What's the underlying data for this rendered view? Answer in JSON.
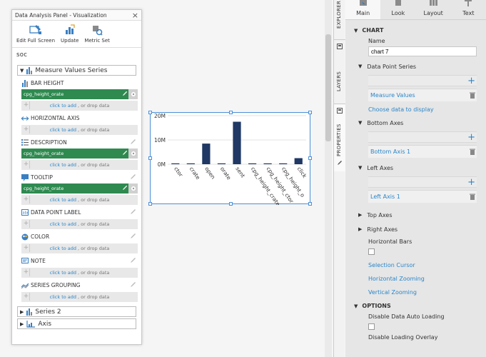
{
  "panel": {
    "title": "Data Analysis Panel - Visualization",
    "close_symbol": "×",
    "toolbar": [
      {
        "label": "Edit Full Screen",
        "icon": "edit-fullscreen-icon"
      },
      {
        "label": "Update",
        "icon": "update-icon"
      },
      {
        "label": "Metric Set",
        "icon": "metric-set-icon"
      }
    ],
    "source_name": "soc",
    "group_main": "Measure Values Series",
    "sections": [
      {
        "title": "BAR HEIGHT",
        "icon": "bar-height-icon",
        "chip": "cpg_height_orate"
      },
      {
        "title": "HORIZONTAL AXIS",
        "icon": "horizontal-axis-icon",
        "chip": null
      },
      {
        "title": "DESCRIPTION",
        "icon": "description-icon",
        "chip": "cpg_height_orate"
      },
      {
        "title": "TOOLTIP",
        "icon": "tooltip-icon",
        "chip": "cpg_height_orate"
      },
      {
        "title": "DATA POINT LABEL",
        "icon": "data-point-label-icon",
        "chip": null
      },
      {
        "title": "COLOR",
        "icon": "color-icon",
        "chip": null
      },
      {
        "title": "NOTE",
        "icon": "note-icon",
        "chip": null
      },
      {
        "title": "SERIES GROUPING",
        "icon": "series-grouping-icon",
        "chip": null
      }
    ],
    "dropzone_link": "click to add",
    "dropzone_rest": ", or drop data",
    "group_series2": "Series 2",
    "group_axis": "Axis",
    "chip_color": "#2f8a50"
  },
  "chart_data": {
    "type": "bar",
    "categories": [
      "ctor",
      "crate",
      "open",
      "orate",
      "sent",
      "cpg_height_crate",
      "cpg_height_ctor",
      "cpg_height_o",
      "click"
    ],
    "values": [
      0,
      0,
      8500000,
      0,
      17500000,
      0,
      0,
      0,
      2500000
    ],
    "ytick_labels": [
      "0M",
      "10M",
      "20M"
    ],
    "ylim": [
      0,
      20000000
    ],
    "bar_color": "#1f3864",
    "title": "",
    "xlabel": "",
    "ylabel": ""
  },
  "side_tabs": [
    {
      "label": "EXPLORER",
      "icon": "explorer-icon"
    },
    {
      "label": "LAYERS",
      "icon": "layers-icon"
    },
    {
      "label": "PROPERTIES",
      "icon": "properties-icon"
    }
  ],
  "props": {
    "tabs": [
      {
        "label": "Main",
        "icon": "main-icon"
      },
      {
        "label": "Look",
        "icon": "look-icon"
      },
      {
        "label": "Layout",
        "icon": "layout-icon"
      },
      {
        "label": "Text",
        "icon": "text-icon"
      }
    ],
    "chart_section": "CHART",
    "name_label": "Name",
    "name_value": "chart 7",
    "data_point_series": "Data Point Series",
    "measure_values": "Measure Values",
    "choose_data": "Choose data to display",
    "bottom_axes": "Bottom Axes",
    "bottom_axis_1": "Bottom Axis 1",
    "left_axes": "Left Axes",
    "left_axis_1": "Left Axis 1",
    "top_axes": "Top Axes",
    "right_axes": "Right Axes",
    "horizontal_bars": "Horizontal Bars",
    "selection_cursor": "Selection Cursor",
    "horizontal_zooming": "Horizontal Zooming",
    "vertical_zooming": "Vertical Zooming",
    "options_section": "OPTIONS",
    "disable_auto_loading": "Disable Data Auto Loading",
    "disable_loading_overlay": "Disable Loading Overlay",
    "accent_color": "#2a86c9"
  }
}
